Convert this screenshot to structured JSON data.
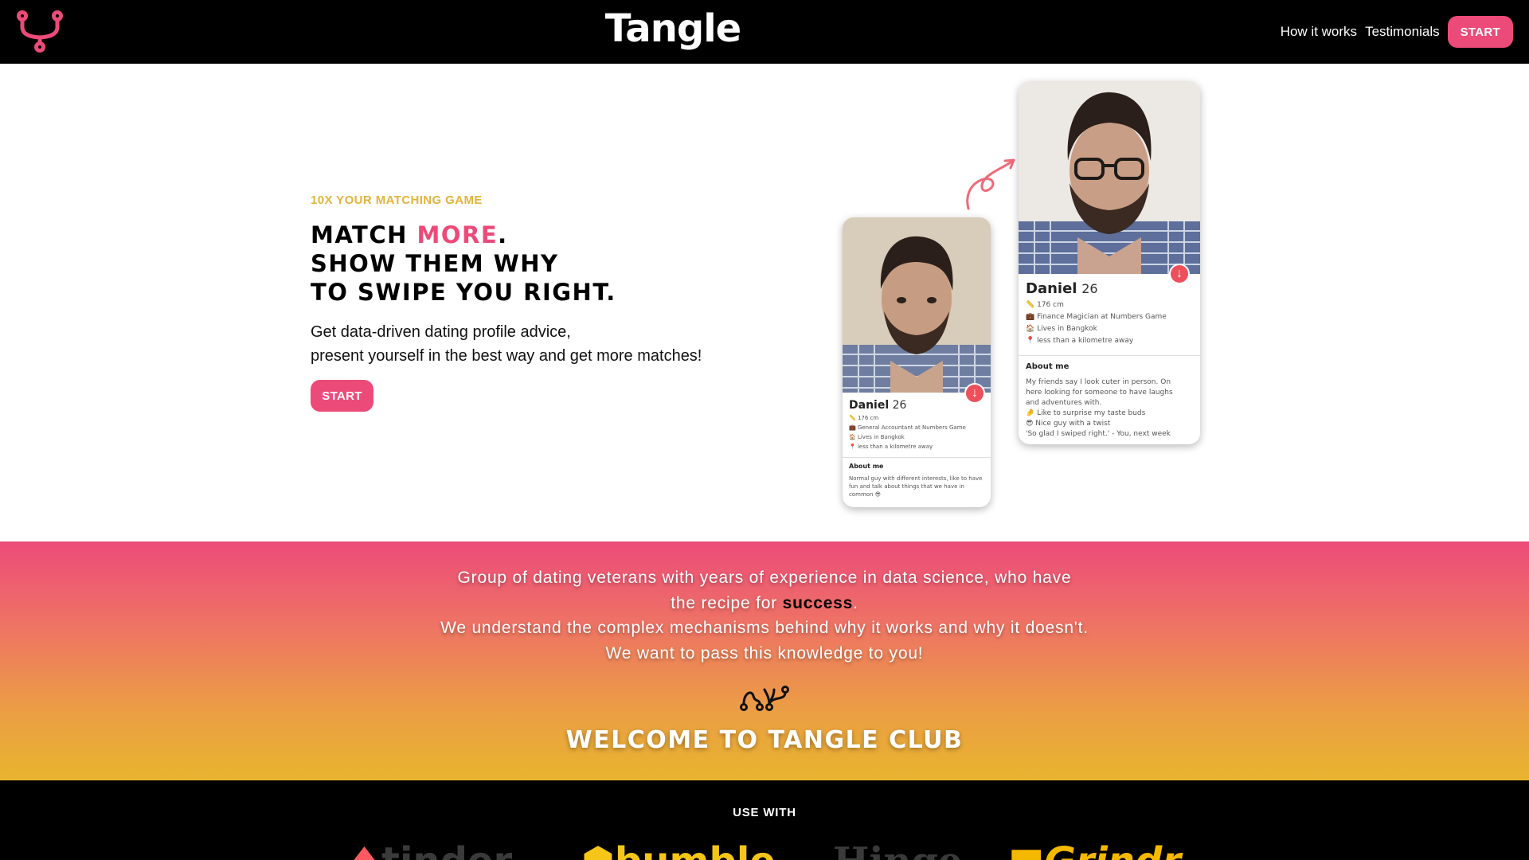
{
  "nav": {
    "brand": "Tangle",
    "links": [
      "How it works",
      "Testimonials"
    ],
    "start_label": "START",
    "logo_icon": "tangle-fork-icon"
  },
  "hero": {
    "eyebrow": "10X YOUR MATCHING GAME",
    "headline": {
      "line1_prefix": "MATCH ",
      "line1_highlight": "MORE",
      "line1_suffix": ".",
      "line2": "SHOW THEM WHY",
      "line3": "TO SWIPE YOU RIGHT."
    },
    "lead_line1": "Get data-driven dating profile advice,",
    "lead_line2": "present yourself in the best way and get more matches!",
    "start_label": "START"
  },
  "cards": {
    "before": {
      "name": "Daniel",
      "age": "26",
      "height": "176 cm",
      "job": "General Accountant at Numbers Game",
      "location": "Lives in Bangkok",
      "distance": "less than a kilometre away",
      "about_title": "About me",
      "about_text": "Normal guy with different interests, like to have fun and talk about things that we have in common 😎"
    },
    "after": {
      "name": "Daniel",
      "age": "26",
      "height": "176 cm",
      "job": "Finance Magician at Numbers Game",
      "location": "Lives in Bangkok",
      "distance": "less than a kilometre away",
      "about_title": "About me",
      "about_lines": [
        "My friends say I look cuter in person. On",
        "here looking for someone to have laughs",
        "and adventures with.",
        "🤌 Like to surprise my taste buds",
        "😎 Nice guy with a twist",
        "'So glad I swiped right.' - You, next week"
      ]
    }
  },
  "band": {
    "line1": "Group of dating veterans with years of experience in data science, who have",
    "line2_prefix": "the recipe for ",
    "line2_highlight": "success",
    "line2_suffix": ".",
    "line3": "We understand the complex mechanisms behind why it works and why it doesn't.",
    "line4": "We want to pass this knowledge to you!",
    "title": "WELCOME TO TANGLE CLUB",
    "icon": "tangle-knot-icon"
  },
  "bottom": {
    "use_with": "USE WITH",
    "apps": [
      "tinder",
      "bumble",
      "Hinge",
      "Grindr"
    ]
  },
  "colors": {
    "accent_pink": "#ec4b7a",
    "accent_gold": "#e2b43c",
    "nav_bg": "#000000"
  }
}
